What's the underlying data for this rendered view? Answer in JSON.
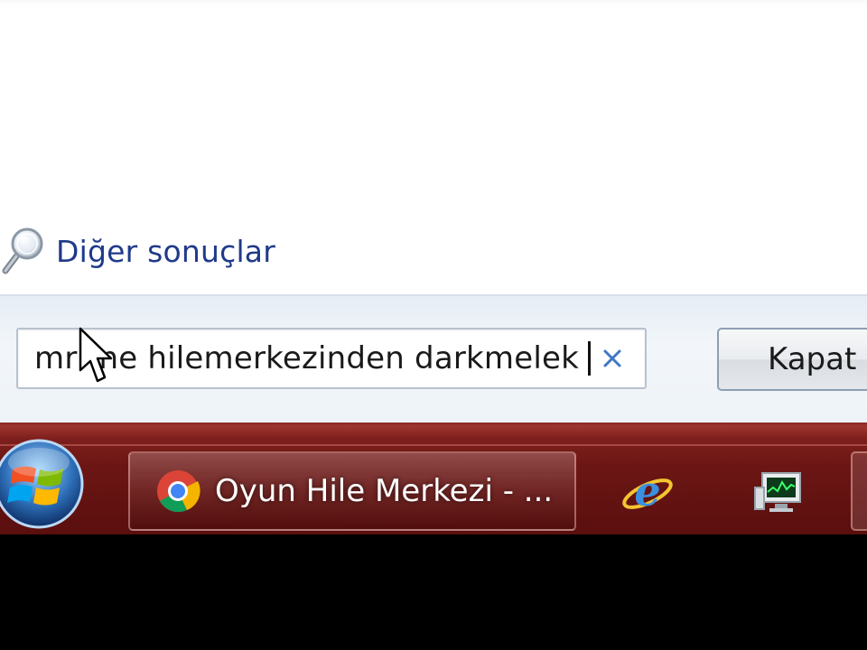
{
  "start_menu": {
    "more_results_label": "Diğer sonuçlar",
    "search": {
      "value": "mrme hilemerkezinden darkmelek",
      "value_before_cursor": "mr",
      "value_after_cursor": "ne hilemerkezinden darkmelek"
    },
    "close_button_label": "Kapat"
  },
  "taskbar": {
    "active_window_label": "Oyun Hile Merkezi - ...",
    "icons": [
      "windows-start-orb",
      "chrome-icon",
      "internet-explorer-icon",
      "task-monitor-icon"
    ]
  },
  "colors": {
    "link": "#1f3a8a",
    "taskbar": "#6b1614",
    "search_border": "#b8c2cf"
  }
}
